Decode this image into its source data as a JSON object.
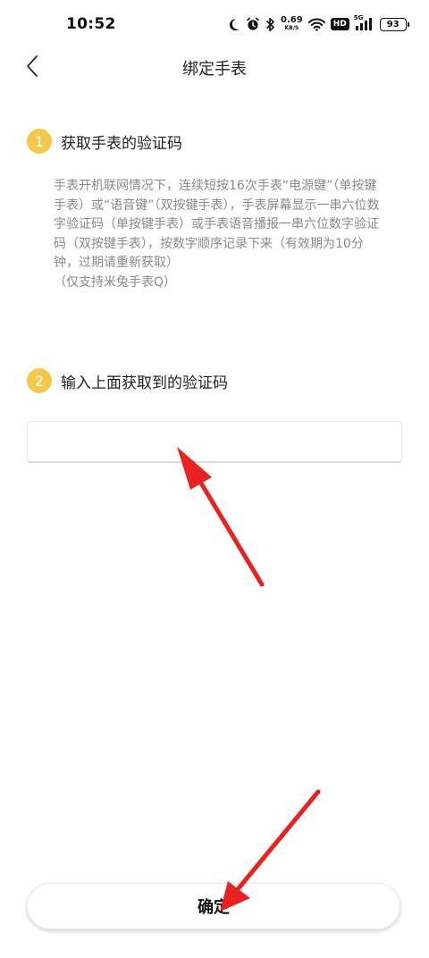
{
  "status_bar": {
    "time": "10:52",
    "net_speed_value": "0.69",
    "net_speed_unit": "KB/S",
    "hd_label": "HD",
    "signal_label": "5G",
    "battery": "93"
  },
  "nav": {
    "title": "绑定手表"
  },
  "step1": {
    "number": "1",
    "title": "获取手表的验证码",
    "description": "手表开机联网情况下，连续短按16次手表“电源键”（单按键手表）或“语音键”（双按键手表），手表屏幕显示一串六位数字验证码（单按键手表）或手表语音播报一串六位数字验证码（双按键手表），按数字顺序记录下来（有效期为10分钟，过期请重新获取）",
    "note": "（仅支持米兔手表Q）"
  },
  "step2": {
    "number": "2",
    "title": "输入上面获取到的验证码"
  },
  "code_input": {
    "value": "",
    "placeholder": ""
  },
  "confirm_button": {
    "label": "确定"
  },
  "colors": {
    "accent": "#f6c84a",
    "annotation_arrow": "#e8231f",
    "description_text": "#8a8a8a"
  }
}
